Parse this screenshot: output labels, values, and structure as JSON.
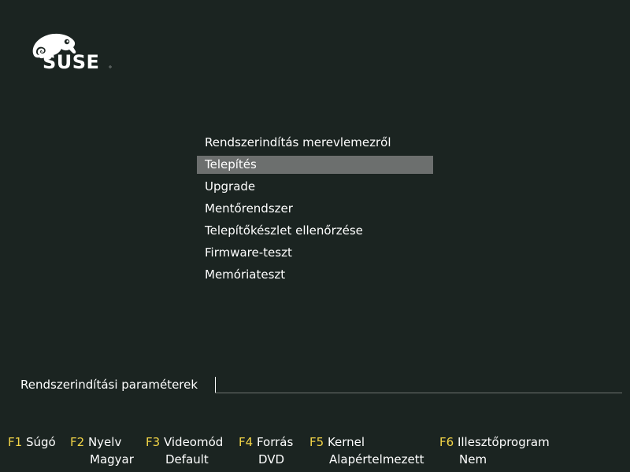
{
  "logo": {
    "text": "SUSE"
  },
  "menu": {
    "items": [
      {
        "label": "Rendszerindítás merevlemezről"
      },
      {
        "label": "Telepítés"
      },
      {
        "label": "Upgrade"
      },
      {
        "label": "Mentőrendszer"
      },
      {
        "label": "Telepítőkészlet ellenőrzése"
      },
      {
        "label": "Firmware-teszt"
      },
      {
        "label": "Memóriateszt"
      }
    ],
    "selected_index": 1
  },
  "boot": {
    "label": "Rendszerindítási paraméterek",
    "value": ""
  },
  "fkeys": [
    {
      "key": "F1",
      "label": "Súgó",
      "value": ""
    },
    {
      "key": "F2",
      "label": "Nyelv",
      "value": "Magyar"
    },
    {
      "key": "F3",
      "label": "Videomód",
      "value": "Default"
    },
    {
      "key": "F4",
      "label": "Forrás",
      "value": "DVD"
    },
    {
      "key": "F5",
      "label": "Kernel",
      "value": "Alapértelmezett"
    },
    {
      "key": "F6",
      "label": "Illesztőprogram",
      "value": "Nem"
    }
  ],
  "colors": {
    "background": "#1b2421",
    "highlight": "#6c6f6e",
    "fkey": "#f3d547",
    "text": "#ffffff"
  }
}
